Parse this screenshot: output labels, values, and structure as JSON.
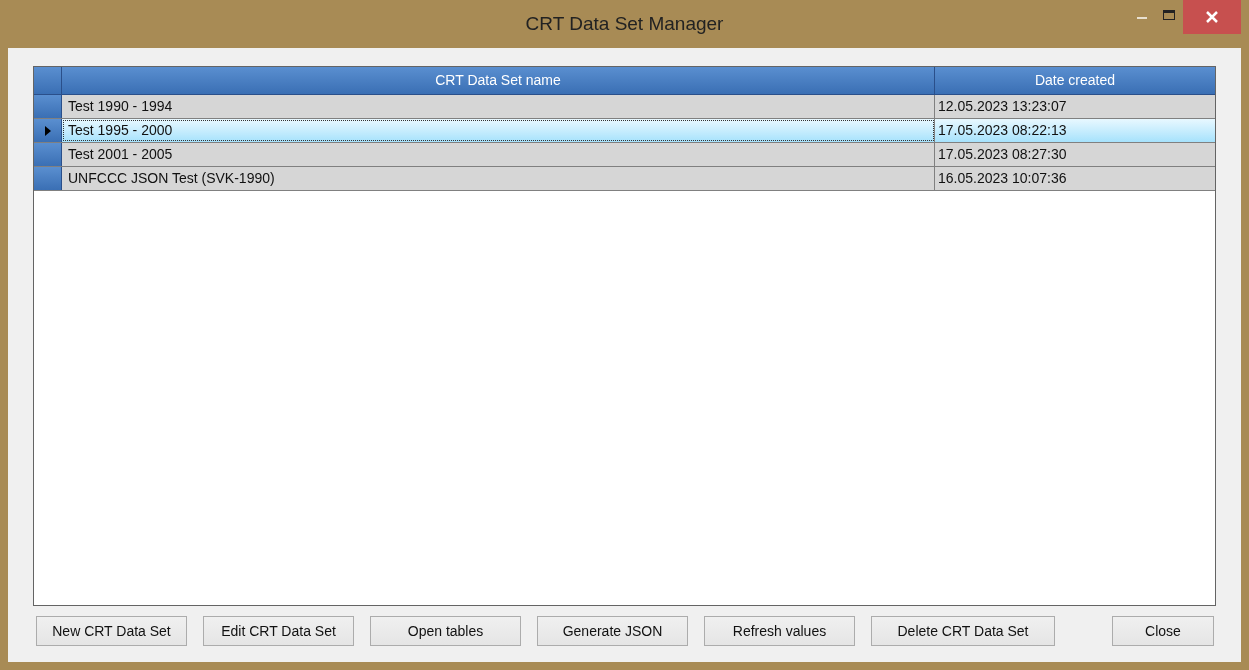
{
  "window": {
    "title": "CRT Data Set Manager"
  },
  "table": {
    "columns": [
      "CRT Data Set name",
      "Date created"
    ],
    "rows": [
      {
        "name": "Test 1990 - 1994",
        "date": "12.05.2023 13:23:07",
        "selected": false
      },
      {
        "name": "Test 1995 - 2000",
        "date": "17.05.2023 08:22:13",
        "selected": true
      },
      {
        "name": "Test 2001 - 2005",
        "date": "17.05.2023 08:27:30",
        "selected": false
      },
      {
        "name": "UNFCCC JSON Test (SVK-1990)",
        "date": "16.05.2023 10:07:36",
        "selected": false
      }
    ]
  },
  "buttons": [
    {
      "label": "New CRT Data Set",
      "kind": "action"
    },
    {
      "label": "Edit CRT Data Set",
      "kind": "action"
    },
    {
      "label": "Open tables",
      "kind": "action"
    },
    {
      "label": "Generate JSON",
      "kind": "action"
    },
    {
      "label": "Refresh values",
      "kind": "action"
    },
    {
      "label": "Delete CRT Data Set",
      "kind": "action"
    },
    {
      "label": "Close",
      "kind": "close"
    }
  ]
}
